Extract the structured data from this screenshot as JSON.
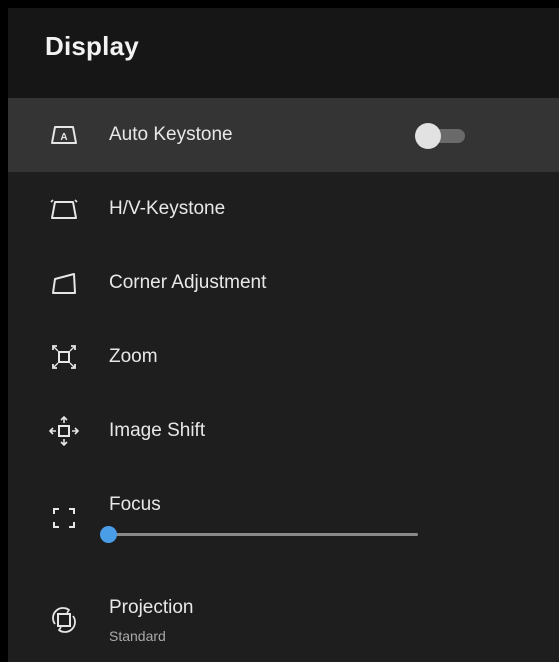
{
  "header": {
    "title": "Display"
  },
  "menu": {
    "auto_keystone": {
      "label": "Auto Keystone",
      "icon": "auto-keystone-icon",
      "toggle_on": false
    },
    "hv_keystone": {
      "label": "H/V-Keystone",
      "icon": "keystone-icon"
    },
    "corner_adjustment": {
      "label": "Corner Adjustment",
      "icon": "corner-adjustment-icon"
    },
    "zoom": {
      "label": "Zoom",
      "icon": "zoom-icon"
    },
    "image_shift": {
      "label": "Image Shift",
      "icon": "image-shift-icon"
    },
    "focus": {
      "label": "Focus",
      "icon": "focus-icon",
      "slider_value": 0
    },
    "projection": {
      "label": "Projection",
      "value": "Standard",
      "icon": "projection-icon"
    }
  },
  "colors": {
    "accent": "#4a9ee8",
    "selected_row": "#343434",
    "background": "#1e1e1e",
    "header": "#161616"
  }
}
